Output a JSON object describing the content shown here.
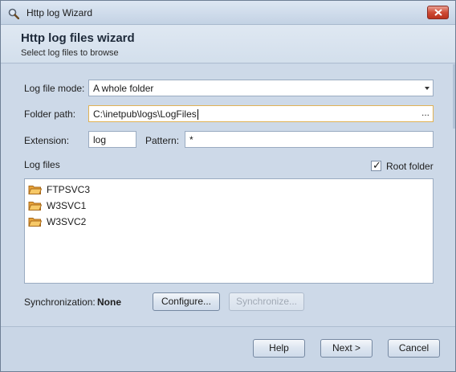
{
  "window": {
    "title": "Http log Wizard"
  },
  "header": {
    "title": "Http log files wizard",
    "subtitle": "Select log files to browse"
  },
  "form": {
    "mode_label": "Log file mode:",
    "mode_value": "A whole folder",
    "folder_label": "Folder path:",
    "folder_value": "C:\\inetpub\\logs\\LogFiles",
    "folder_browse": "...",
    "extension_label": "Extension:",
    "extension_value": "log",
    "pattern_label": "Pattern:",
    "pattern_value": "*",
    "log_files_label": "Log files",
    "root_folder_label": "Root folder",
    "root_folder_checked": true
  },
  "log_files": [
    "FTPSVC3",
    "W3SVC1",
    "W3SVC2"
  ],
  "sync": {
    "label": "Synchronization:",
    "value": "None",
    "configure": "Configure...",
    "synchronize": "Synchronize..."
  },
  "footer": {
    "help": "Help",
    "next": "Next >",
    "cancel": "Cancel"
  },
  "colors": {
    "window_bg": "#cdd9e8",
    "focus_border": "#e0b255",
    "close_button": "#cf4b35",
    "folder": "#e8a33a"
  }
}
